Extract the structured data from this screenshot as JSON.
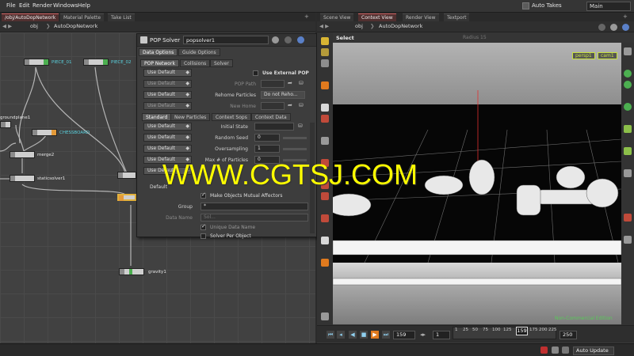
{
  "menu": [
    "File",
    "Edit",
    "Render",
    "Windows",
    "Help"
  ],
  "top_right": {
    "auto_takes_label": "Auto Takes",
    "take_value": "Main"
  },
  "left_pane": {
    "tabs": [
      "/obj/AutoDopNetwork",
      "Material Palette",
      "Take List"
    ],
    "path": {
      "context": "obj",
      "network": "AutoDopNetwork"
    },
    "nodes": [
      {
        "label": "PIECE_01"
      },
      {
        "label": "PIECE_02"
      },
      {
        "label": "groundplane1"
      },
      {
        "label": "CHESSBOARD"
      },
      {
        "label": "merge2"
      },
      {
        "label": "staticsolver1"
      },
      {
        "label": "gravity1"
      }
    ]
  },
  "pop_panel": {
    "type_label": "POP Solver",
    "node_name": "popsolver1",
    "top_tabs": [
      "Data Options",
      "Guide Options"
    ],
    "sub_tabs": [
      "POP Network",
      "Collisions",
      "Solver"
    ],
    "use_default": "Use Default",
    "use_external_pop": "Use External POP",
    "pop_path_label": "POP Path",
    "rehome_label": "Rehome Particles",
    "rehome_value": "Do not Reho...",
    "new_home_label": "New Home",
    "inner_tabs": [
      "Standard",
      "New Particles",
      "Context Sops",
      "Context Data"
    ],
    "initial_state_label": "Initial State",
    "random_seed_label": "Random Seed",
    "random_seed_value": "0",
    "oversampling_label": "Oversampling",
    "oversampling_value": "1",
    "max_particles_label": "Max # of Particles",
    "max_particles_value": "0",
    "default_operation": "Default",
    "make_mutual": "Make Objects Mutual Affectors",
    "group_label": "Group",
    "group_value": "*",
    "data_name_label": "Data Name",
    "data_name_value": "Sol...",
    "unique_data_name": "Unique Data Name",
    "solver_per_object": "Solver Per Object"
  },
  "right_pane": {
    "tabs": [
      "Scene View",
      "Context View",
      "Render View",
      "Textport"
    ],
    "path": {
      "context": "obj",
      "network": "AutoDopNetwork"
    },
    "select_label": "Select",
    "radius_label": "Radius 15",
    "camera_persp": "persp1",
    "camera_cam": "cam1",
    "watermark": "WWW.CGTSJ.COM",
    "edition": "Non-Commercial Edition"
  },
  "timeline": {
    "current_frame": "159",
    "step": "1",
    "ruler_ticks": [
      "1",
      "25",
      "50",
      "75",
      "100",
      "125",
      "150",
      "175",
      "200",
      "225"
    ],
    "playhead": "159",
    "end_frame": "250"
  },
  "status": {
    "auto_update": "Auto Update"
  },
  "colors": {
    "accent_orange": "#e07a1e",
    "node_cyan": "#5ad3e0",
    "camera_yellow": "#c8e23c",
    "watermark_yellow": "#ffff00"
  }
}
